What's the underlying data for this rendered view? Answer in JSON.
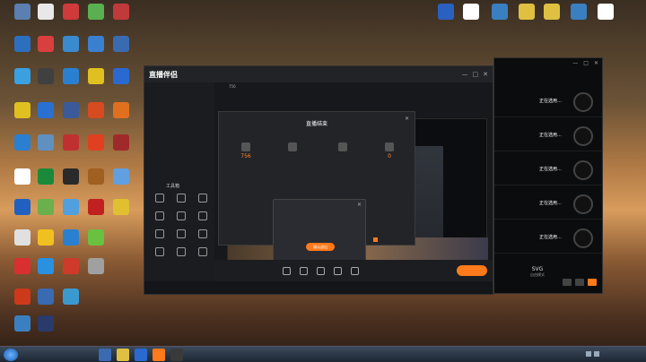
{
  "desktop": {
    "icons_left": [
      {
        "label": "",
        "color": "#5a7fb0"
      },
      {
        "label": "",
        "color": "#2c6fbf"
      },
      {
        "label": "",
        "color": "#3aa0e0"
      },
      {
        "label": "",
        "color": "#e0c020"
      },
      {
        "label": "",
        "color": "#2a7fd0"
      },
      {
        "label": "",
        "color": "#ffffff"
      },
      {
        "label": "",
        "color": "#2060c0"
      },
      {
        "label": "",
        "color": "#e0e0e0"
      },
      {
        "label": "",
        "color": "#d83030"
      },
      {
        "label": "",
        "color": "#cc3a1a"
      },
      {
        "label": "",
        "color": "#3a80c0"
      },
      {
        "label": "",
        "color": "#e8e8e8"
      },
      {
        "label": "",
        "color": "#d84040"
      },
      {
        "label": "",
        "color": "#404040"
      },
      {
        "label": "",
        "color": "#2a70d0"
      },
      {
        "label": "",
        "color": "#6090c0"
      },
      {
        "label": "",
        "color": "#1a8a3a"
      },
      {
        "label": "",
        "color": "#6ab04c"
      },
      {
        "label": "",
        "color": "#f0c020"
      },
      {
        "label": "",
        "color": "#2a90e0"
      },
      {
        "label": "",
        "color": "#3a6ab0"
      },
      {
        "label": "",
        "color": "#2a3a6a"
      },
      {
        "label": "",
        "color": "#d03a3a"
      },
      {
        "label": "",
        "color": "#3a8ad0"
      },
      {
        "label": "",
        "color": "#2a80d0"
      },
      {
        "label": "",
        "color": "#3a5a9a"
      },
      {
        "label": "",
        "color": "#c03030"
      },
      {
        "label": "",
        "color": "#2a2a2a"
      },
      {
        "label": "",
        "color": "#50a0e0"
      },
      {
        "label": "",
        "color": "#2a80d0"
      },
      {
        "label": "",
        "color": "#d03a2a"
      },
      {
        "label": "",
        "color": "#3a9ad0"
      },
      {
        "label": "",
        "color": "#5ab050"
      },
      {
        "label": "",
        "color": "#3a80d0"
      },
      {
        "label": "",
        "color": "#e0c020"
      },
      {
        "label": "",
        "color": "#d84a20"
      },
      {
        "label": "",
        "color": "#e04020"
      },
      {
        "label": "",
        "color": "#a06020"
      },
      {
        "label": "",
        "color": "#c02020"
      },
      {
        "label": "",
        "color": "#6ac040"
      },
      {
        "label": "",
        "color": "#a0a0a0"
      },
      {
        "label": "",
        "color": "#c03a3a"
      },
      {
        "label": "",
        "color": "#3a6ab0"
      },
      {
        "label": "",
        "color": "#2a6ad0"
      },
      {
        "label": "",
        "color": "#e07020"
      },
      {
        "label": "",
        "color": "#a02a2a"
      },
      {
        "label": "",
        "color": "#60a0e0"
      },
      {
        "label": "",
        "color": "#e0c030"
      }
    ],
    "icons_right": [
      {
        "label": "",
        "color": "#2a60c0"
      },
      {
        "label": "",
        "color": "#ffffff"
      },
      {
        "label": "",
        "color": "#3a80c0"
      },
      {
        "label": "",
        "color": "#e0c040"
      },
      {
        "label": "",
        "color": "#e0c040"
      },
      {
        "label": "",
        "color": "#3a80c0"
      },
      {
        "label": "",
        "color": "#ffffff"
      }
    ]
  },
  "app": {
    "logo": "直播伴侣",
    "nav_tabs": [
      "",
      "",
      "",
      ""
    ],
    "scene_label": "",
    "count": "756",
    "tools_header": "工具箱",
    "tools": [
      {
        "label": ""
      },
      {
        "label": ""
      },
      {
        "label": ""
      },
      {
        "label": ""
      },
      {
        "label": ""
      },
      {
        "label": ""
      },
      {
        "label": ""
      },
      {
        "label": ""
      },
      {
        "label": ""
      },
      {
        "label": ""
      },
      {
        "label": ""
      },
      {
        "label": ""
      }
    ],
    "controls": [
      {
        "label": ""
      },
      {
        "label": ""
      },
      {
        "label": ""
      },
      {
        "label": ""
      },
      {
        "label": ""
      }
    ],
    "start_button": "",
    "status": {
      "left": "",
      "right": ""
    },
    "end_panel": {
      "title": "直播结束",
      "duration": "",
      "stats": [
        {
          "value": "756",
          "label": ""
        },
        {
          "value": "",
          "label": ""
        },
        {
          "value": "",
          "label": ""
        },
        {
          "value": "0",
          "label": ""
        }
      ],
      "checkbox_label": ""
    },
    "dialog": {
      "title": "",
      "message": "",
      "sub": "",
      "confirm": "确认退出"
    }
  },
  "camera": {
    "slots": [
      {
        "title": "正在选用…",
        "sub": ""
      },
      {
        "title": "正在选用…",
        "sub": ""
      },
      {
        "title": "正在选用…",
        "sub": ""
      },
      {
        "title": "正在选用…",
        "sub": ""
      },
      {
        "title": "正在选用…",
        "sub": ""
      }
    ],
    "mode": "SVG",
    "mode_label": "自由模式"
  },
  "taskbar": {
    "apps": [
      "",
      "",
      "",
      "",
      ""
    ],
    "time": "",
    "date": ""
  },
  "colors": {
    "accent": "#ff7a1a",
    "app_bg": "#17181c"
  }
}
